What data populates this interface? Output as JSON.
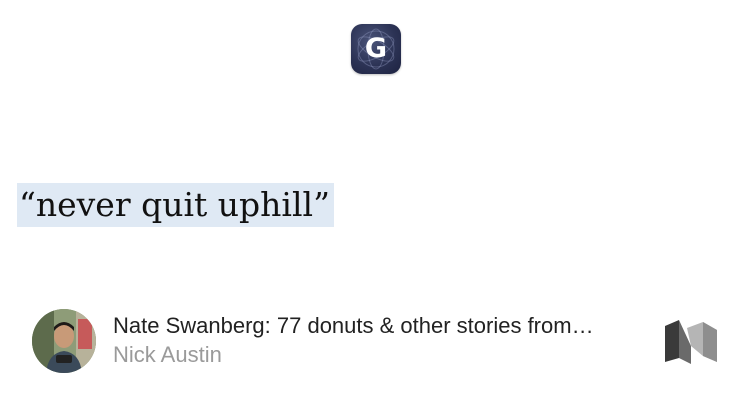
{
  "app": {
    "icon_name": "g-app-icon",
    "letter": "G",
    "color": "#2c3355"
  },
  "quote": {
    "text": "“never quit uphill”",
    "highlight_color": "#dfe9f4"
  },
  "story": {
    "title": "Nate Swanberg: 77 donuts & other stories from…",
    "author": "Nick Austin",
    "avatar_icon": "author-avatar",
    "source_icon": "medium-logo-icon"
  }
}
